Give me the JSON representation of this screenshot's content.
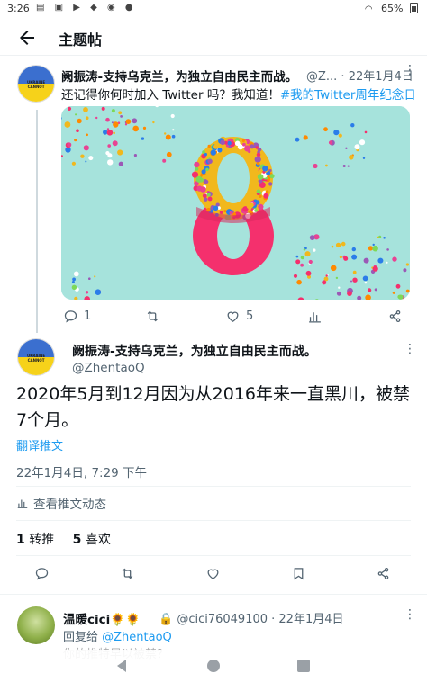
{
  "status_bar": {
    "time": "3:26",
    "battery": "65%"
  },
  "header": {
    "title": "主题帖"
  },
  "tweet1": {
    "display_name": "阙振涛-支持乌克兰，为独立自由民主而战。",
    "handle_date": "@Z... · 22年1月4日",
    "text": "还记得你何时加入 Twitter 吗？我知道！",
    "hashtag": "#我的Twitter周年纪念日",
    "reply_count": "1",
    "retweet_count": "",
    "like_count": "5",
    "avatar_caption": "UKRAINE CANNOT"
  },
  "tweet2": {
    "display_name": "阙振涛-支持乌克兰，为独立自由民主而战。",
    "handle": "@ZhentaoQ",
    "text": "2020年5月到12月因为从2016年来一直黑川，被禁7个月。",
    "translate_label": "翻译推文",
    "timestamp": "22年1月4日, 7:29 下午",
    "activity_label": "查看推文动态",
    "retweets": "1",
    "retweets_label": "转推",
    "likes": "5",
    "likes_label": "喜欢"
  },
  "tweet3": {
    "display_name": "温暖cici🌻🌻",
    "handle_date": "@cici76049100 · 22年1月4日",
    "reply_prefix": "回复给",
    "reply_to": "@ZhentaoQ",
    "preview": "你的推特早以被禁？"
  },
  "colors": {
    "accent": "#1d9bf0",
    "secondary_text": "#536471",
    "media_bg": "#a6e3dc"
  }
}
